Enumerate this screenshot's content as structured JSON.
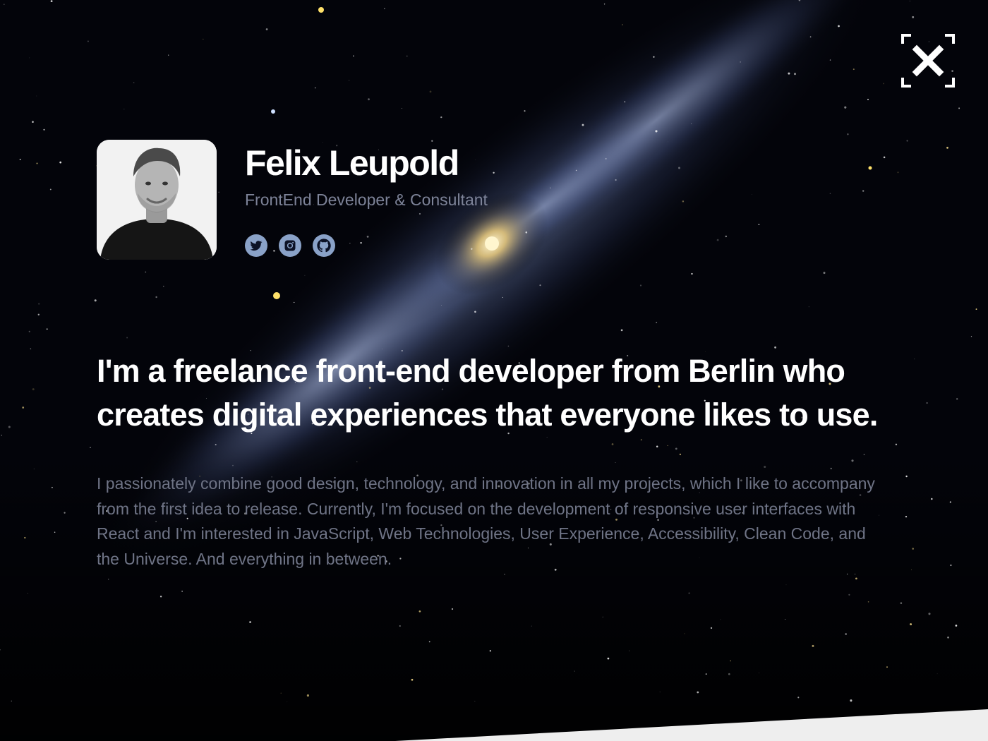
{
  "profile": {
    "name": "Felix Leupold",
    "role": "FrontEnd Developer & Consultant",
    "avatar_icon": "portrait-photo",
    "socials": [
      {
        "name": "twitter",
        "icon": "twitter-icon",
        "label": "Twitter"
      },
      {
        "name": "instagram",
        "icon": "instagram-icon",
        "label": "Instagram"
      },
      {
        "name": "github",
        "icon": "github-icon",
        "label": "GitHub"
      }
    ]
  },
  "headline": "I'm a freelance front-end developer from Berlin who creates digital experiences that everyone likes to use.",
  "bio": "I passionately combine good design, technology, and innovation in all my projects, which I like to accompany from the first idea to release. Currently, I'm focused on the development of responsive user interfaces with React and I'm interested in JavaScript, Web Technologies, User Experience, Accessibility, Clean Code, and the Universe. And everything in between.",
  "close": {
    "icon": "close-icon",
    "label": "Close"
  },
  "colors": {
    "background": "#000000",
    "role_text": "#7d8398",
    "bio_text": "#6f7486",
    "social_icon": "#8aa2c8",
    "bottom_band": "#eeeeee"
  }
}
